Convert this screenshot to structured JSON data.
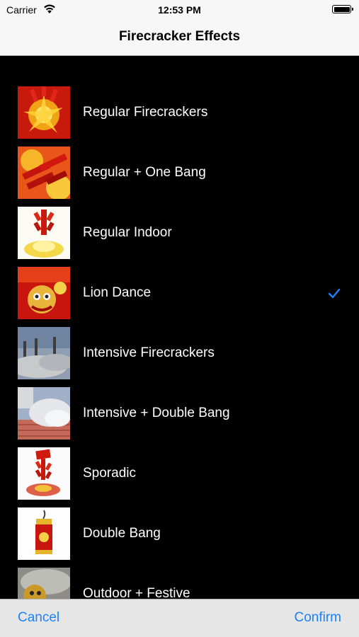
{
  "status_bar": {
    "carrier": "Carrier",
    "time": "12:53 PM",
    "wifi_icon": "wifi-icon",
    "battery_icon": "battery-icon"
  },
  "nav": {
    "title": "Firecracker Effects"
  },
  "list": {
    "items": [
      {
        "label": "Regular Firecrackers",
        "thumbnail": "red-firecracker-burst",
        "selected": false
      },
      {
        "label": "Regular + One Bang",
        "thumbnail": "red-firecracker-bundle",
        "selected": false
      },
      {
        "label": "Regular Indoor",
        "thumbnail": "hanging-firecracker-string",
        "selected": false
      },
      {
        "label": "Lion Dance",
        "thumbnail": "lion-dance-head",
        "selected": true
      },
      {
        "label": "Intensive Firecrackers",
        "thumbnail": "smoke-over-plaza",
        "selected": false
      },
      {
        "label": "Intensive + Double Bang",
        "thumbnail": "smoke-on-steps",
        "selected": false
      },
      {
        "label": "Sporadic",
        "thumbnail": "firecracker-string-on-white",
        "selected": false
      },
      {
        "label": "Double Bang",
        "thumbnail": "single-cylinder-firecracker",
        "selected": false
      },
      {
        "label": "Outdoor + Festive",
        "thumbnail": "lion-dance-smoke",
        "selected": false
      }
    ],
    "checkmark_icon": "checkmark-icon"
  },
  "bottom_bar": {
    "cancel_label": "Cancel",
    "confirm_label": "Confirm"
  },
  "colors": {
    "accent": "#1a82fb",
    "background": "#000000",
    "bar_background": "#f7f7f7"
  }
}
